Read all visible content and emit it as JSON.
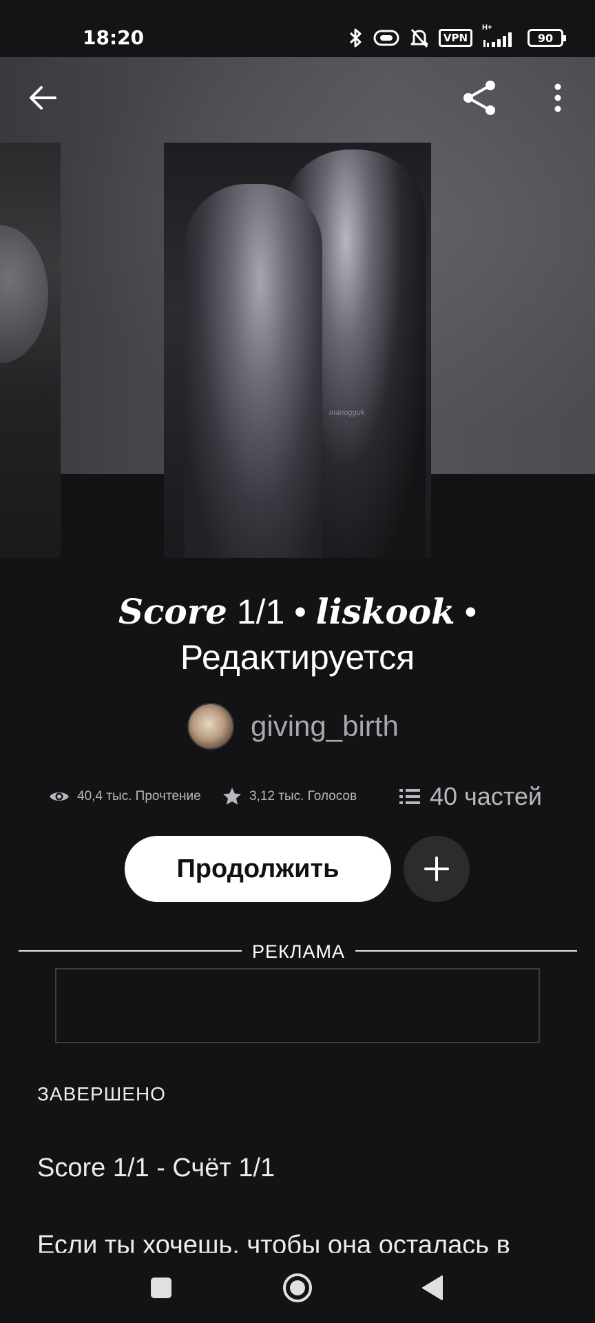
{
  "status_bar": {
    "time": "18:20",
    "vpn": "VPN",
    "network": "H+",
    "battery": "90"
  },
  "cover": {
    "watermark": "manogguk"
  },
  "story": {
    "title_italic_1": "Score",
    "title_plain_1": " 1/1  • ",
    "title_italic_2": "liskook",
    "title_plain_2": " •",
    "title_line_2": "Редактируется",
    "author": "giving_birth"
  },
  "stats": {
    "reads": "40,4 тыс. Прочтение",
    "votes": "3,12 тыс. Голосов",
    "parts": "40 частей"
  },
  "actions": {
    "continue_label": "Продолжить"
  },
  "ad": {
    "label": "РЕКЛАМА"
  },
  "description": {
    "status": "ЗАВЕРШЕНО",
    "title": "Scorе 1/1 - Счёт 1/1",
    "text": "Если ты хочешь, чтобы она осталась в"
  },
  "colors": {
    "background": "#131315",
    "button_primary": "#ffffff",
    "button_secondary": "#2c2c2e",
    "muted_text": "#a8a8ac"
  },
  "icons": {
    "back": "arrow-left-icon",
    "share": "share-icon",
    "more": "more-vertical-icon",
    "reads": "eye-icon",
    "votes": "star-icon",
    "parts": "list-icon",
    "add": "plus-icon"
  }
}
